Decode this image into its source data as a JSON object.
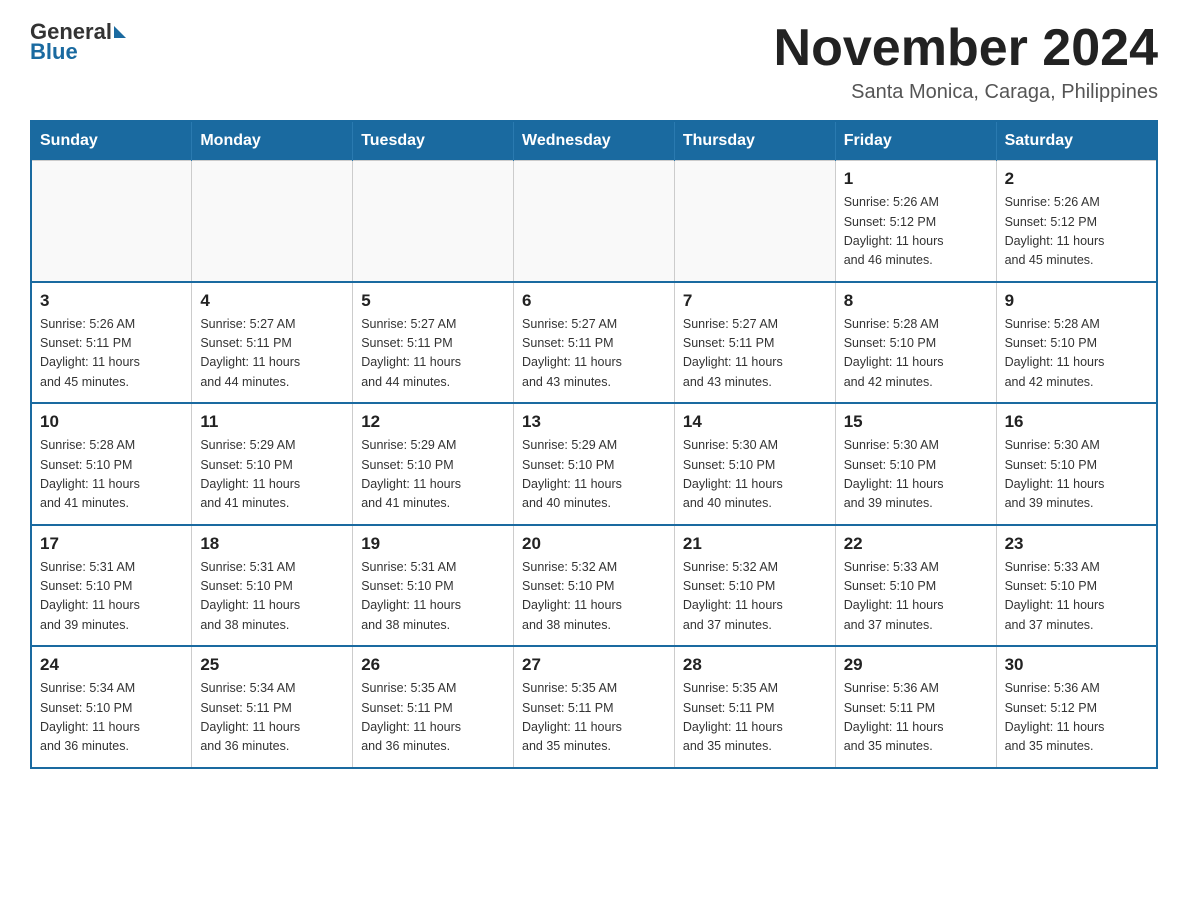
{
  "header": {
    "logo": {
      "general": "General",
      "triangle": "",
      "blue": "Blue"
    },
    "month_title": "November 2024",
    "subtitle": "Santa Monica, Caraga, Philippines"
  },
  "calendar": {
    "days_of_week": [
      "Sunday",
      "Monday",
      "Tuesday",
      "Wednesday",
      "Thursday",
      "Friday",
      "Saturday"
    ],
    "weeks": [
      [
        {
          "day": "",
          "info": ""
        },
        {
          "day": "",
          "info": ""
        },
        {
          "day": "",
          "info": ""
        },
        {
          "day": "",
          "info": ""
        },
        {
          "day": "",
          "info": ""
        },
        {
          "day": "1",
          "info": "Sunrise: 5:26 AM\nSunset: 5:12 PM\nDaylight: 11 hours\nand 46 minutes."
        },
        {
          "day": "2",
          "info": "Sunrise: 5:26 AM\nSunset: 5:12 PM\nDaylight: 11 hours\nand 45 minutes."
        }
      ],
      [
        {
          "day": "3",
          "info": "Sunrise: 5:26 AM\nSunset: 5:11 PM\nDaylight: 11 hours\nand 45 minutes."
        },
        {
          "day": "4",
          "info": "Sunrise: 5:27 AM\nSunset: 5:11 PM\nDaylight: 11 hours\nand 44 minutes."
        },
        {
          "day": "5",
          "info": "Sunrise: 5:27 AM\nSunset: 5:11 PM\nDaylight: 11 hours\nand 44 minutes."
        },
        {
          "day": "6",
          "info": "Sunrise: 5:27 AM\nSunset: 5:11 PM\nDaylight: 11 hours\nand 43 minutes."
        },
        {
          "day": "7",
          "info": "Sunrise: 5:27 AM\nSunset: 5:11 PM\nDaylight: 11 hours\nand 43 minutes."
        },
        {
          "day": "8",
          "info": "Sunrise: 5:28 AM\nSunset: 5:10 PM\nDaylight: 11 hours\nand 42 minutes."
        },
        {
          "day": "9",
          "info": "Sunrise: 5:28 AM\nSunset: 5:10 PM\nDaylight: 11 hours\nand 42 minutes."
        }
      ],
      [
        {
          "day": "10",
          "info": "Sunrise: 5:28 AM\nSunset: 5:10 PM\nDaylight: 11 hours\nand 41 minutes."
        },
        {
          "day": "11",
          "info": "Sunrise: 5:29 AM\nSunset: 5:10 PM\nDaylight: 11 hours\nand 41 minutes."
        },
        {
          "day": "12",
          "info": "Sunrise: 5:29 AM\nSunset: 5:10 PM\nDaylight: 11 hours\nand 41 minutes."
        },
        {
          "day": "13",
          "info": "Sunrise: 5:29 AM\nSunset: 5:10 PM\nDaylight: 11 hours\nand 40 minutes."
        },
        {
          "day": "14",
          "info": "Sunrise: 5:30 AM\nSunset: 5:10 PM\nDaylight: 11 hours\nand 40 minutes."
        },
        {
          "day": "15",
          "info": "Sunrise: 5:30 AM\nSunset: 5:10 PM\nDaylight: 11 hours\nand 39 minutes."
        },
        {
          "day": "16",
          "info": "Sunrise: 5:30 AM\nSunset: 5:10 PM\nDaylight: 11 hours\nand 39 minutes."
        }
      ],
      [
        {
          "day": "17",
          "info": "Sunrise: 5:31 AM\nSunset: 5:10 PM\nDaylight: 11 hours\nand 39 minutes."
        },
        {
          "day": "18",
          "info": "Sunrise: 5:31 AM\nSunset: 5:10 PM\nDaylight: 11 hours\nand 38 minutes."
        },
        {
          "day": "19",
          "info": "Sunrise: 5:31 AM\nSunset: 5:10 PM\nDaylight: 11 hours\nand 38 minutes."
        },
        {
          "day": "20",
          "info": "Sunrise: 5:32 AM\nSunset: 5:10 PM\nDaylight: 11 hours\nand 38 minutes."
        },
        {
          "day": "21",
          "info": "Sunrise: 5:32 AM\nSunset: 5:10 PM\nDaylight: 11 hours\nand 37 minutes."
        },
        {
          "day": "22",
          "info": "Sunrise: 5:33 AM\nSunset: 5:10 PM\nDaylight: 11 hours\nand 37 minutes."
        },
        {
          "day": "23",
          "info": "Sunrise: 5:33 AM\nSunset: 5:10 PM\nDaylight: 11 hours\nand 37 minutes."
        }
      ],
      [
        {
          "day": "24",
          "info": "Sunrise: 5:34 AM\nSunset: 5:10 PM\nDaylight: 11 hours\nand 36 minutes."
        },
        {
          "day": "25",
          "info": "Sunrise: 5:34 AM\nSunset: 5:11 PM\nDaylight: 11 hours\nand 36 minutes."
        },
        {
          "day": "26",
          "info": "Sunrise: 5:35 AM\nSunset: 5:11 PM\nDaylight: 11 hours\nand 36 minutes."
        },
        {
          "day": "27",
          "info": "Sunrise: 5:35 AM\nSunset: 5:11 PM\nDaylight: 11 hours\nand 35 minutes."
        },
        {
          "day": "28",
          "info": "Sunrise: 5:35 AM\nSunset: 5:11 PM\nDaylight: 11 hours\nand 35 minutes."
        },
        {
          "day": "29",
          "info": "Sunrise: 5:36 AM\nSunset: 5:11 PM\nDaylight: 11 hours\nand 35 minutes."
        },
        {
          "day": "30",
          "info": "Sunrise: 5:36 AM\nSunset: 5:12 PM\nDaylight: 11 hours\nand 35 minutes."
        }
      ]
    ]
  }
}
